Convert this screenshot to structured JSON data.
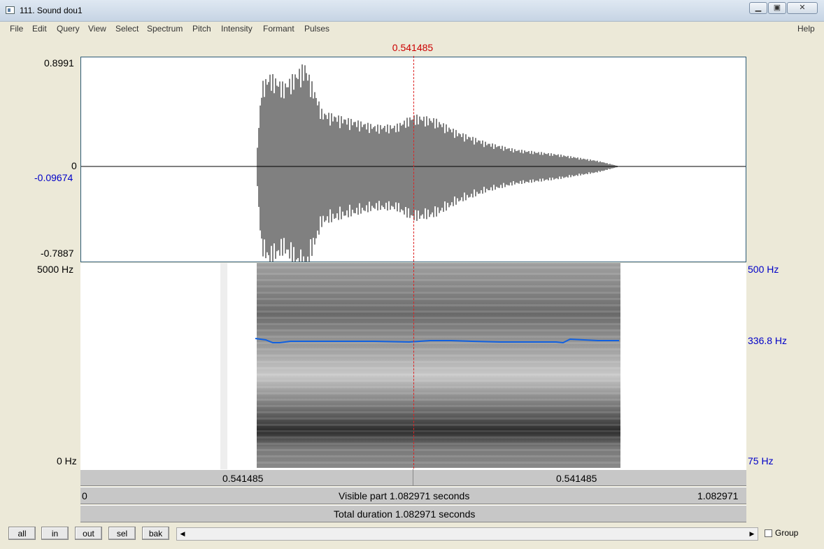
{
  "window": {
    "title": "111. Sound dou1"
  },
  "menu": [
    "File",
    "Edit",
    "Query",
    "View",
    "Select",
    "Spectrum",
    "Pitch",
    "Intensity",
    "Formant",
    "Pulses"
  ],
  "help": "Help",
  "cursor": {
    "time": "0.541485"
  },
  "waveform": {
    "max": "0.8991",
    "zero": "0",
    "cursor_value": "-0.09674",
    "min": "-0.7887"
  },
  "spectrogram": {
    "top": "5000 Hz",
    "bottom": "0 Hz"
  },
  "pitch": {
    "top": "500 Hz",
    "value": "336.8 Hz",
    "bottom": "75 Hz"
  },
  "time_bars": {
    "left_part": "0.541485",
    "right_part": "0.541485",
    "visible_start": "0",
    "visible_label": "Visible part 1.082971 seconds",
    "visible_end": "1.082971",
    "total_label": "Total duration 1.082971 seconds"
  },
  "buttons": [
    "all",
    "in",
    "out",
    "sel",
    "bak"
  ],
  "group_label": "Group",
  "colors": {
    "cursor": "#cc0000",
    "pitch_line": "#1060e0",
    "axis_blue": "#0000c8"
  }
}
